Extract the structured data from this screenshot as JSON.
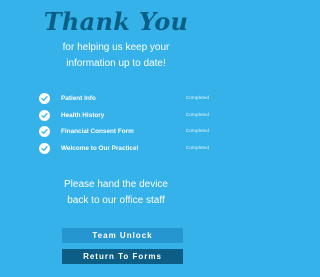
{
  "header": {
    "title": "Thank You",
    "subtitle_lines": [
      "for helping us keep your",
      "information up to date!"
    ]
  },
  "steps": [
    {
      "label": "Patient Info",
      "status": "Completed",
      "icon": "check-circle-icon"
    },
    {
      "label": "Health History",
      "status": "Completed",
      "icon": "check-circle-icon"
    },
    {
      "label": "Financial Consent Form",
      "status": "Completed",
      "icon": "check-circle-icon"
    },
    {
      "label": "Welcome to Our Practice!",
      "status": "Completed",
      "icon": "check-circle-icon"
    }
  ],
  "instruction_lines": [
    "Please hand the device",
    "back to our office staff"
  ],
  "buttons": {
    "team_unlock": "Team Unlock",
    "return_to_forms": "Return To Forms"
  },
  "colors": {
    "background": "#35b2ea",
    "title": "#0b5f84",
    "check_mark": "#35b2ea",
    "team_unlock_button": "#2596d0",
    "return_button": "#0c5e86"
  }
}
